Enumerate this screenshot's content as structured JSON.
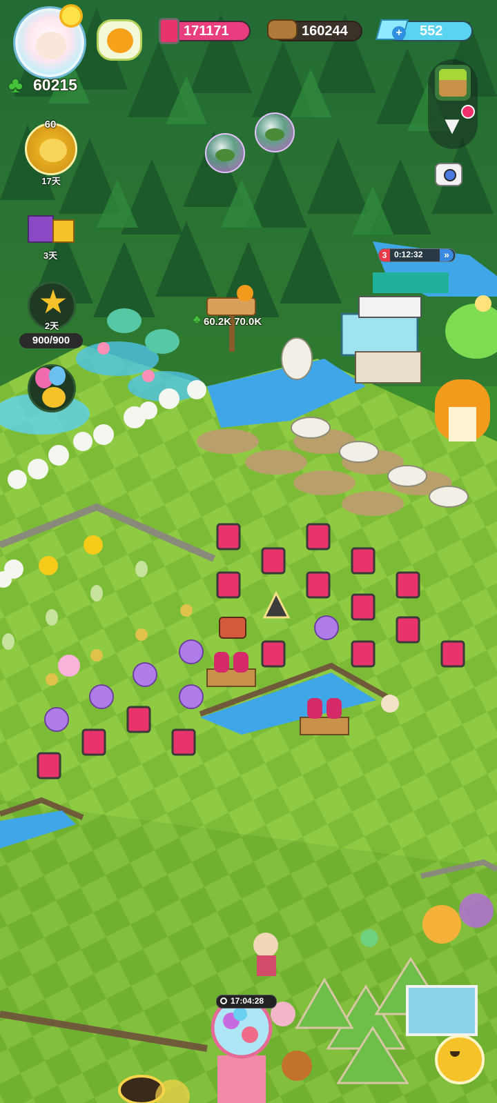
{
  "hud": {
    "clover_count": "60215",
    "jam_count": "171171",
    "wood_count": "160244",
    "gem_count": "552",
    "gem_plus": "+",
    "level": "60"
  },
  "left_panel": {
    "golden_item_days": "17天",
    "gift_days": "3天",
    "star_days": "2天",
    "star_progress": "900/900"
  },
  "right_panel": {
    "collapse_arrow": "▼"
  },
  "signpost": {
    "value": "60.2K 70.0K"
  },
  "event": {
    "count": "3",
    "timer": "0:12:32",
    "fast_forward": "»"
  },
  "bottom": {
    "gacha_timer": "17:04:28"
  },
  "colors": {
    "forest_dark": "#1f5a2a",
    "grass_light": "#8cc63f",
    "grass_dark": "#6cae2e",
    "water": "#3fa6e8",
    "jam_pink": "#e8336b",
    "gem_blue": "#59d3ef"
  }
}
